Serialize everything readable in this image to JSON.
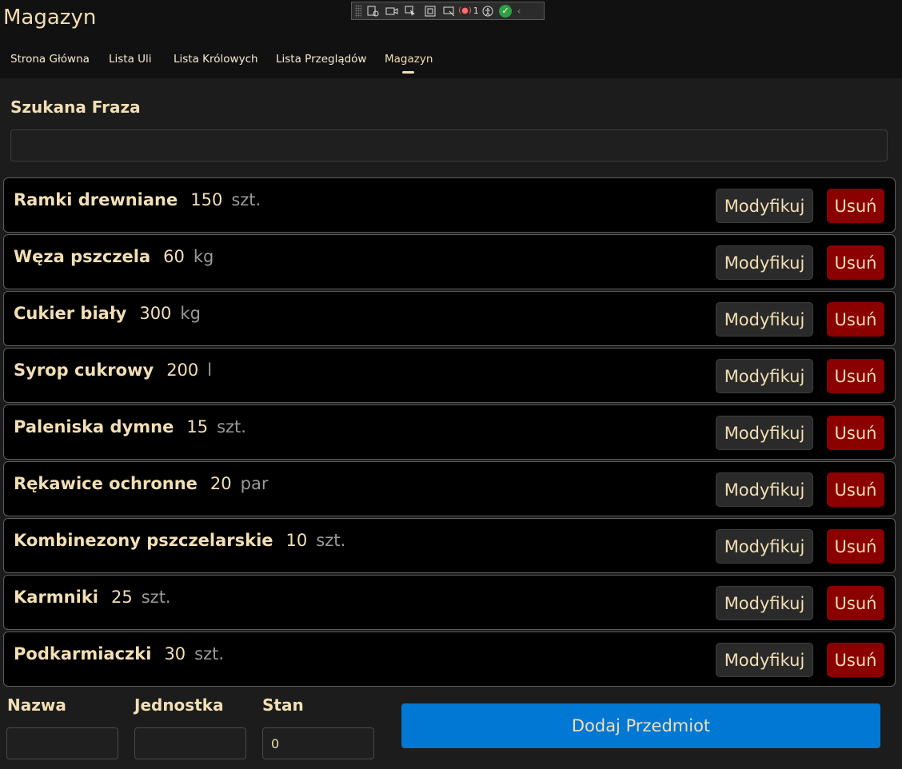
{
  "app": {
    "title": "Magazyn"
  },
  "devtools": {
    "error_count": "1",
    "icons": [
      "grid-icon",
      "video-icon",
      "select-icon",
      "frame-icon",
      "element-icon",
      "error-icon",
      "accessibility-icon",
      "check-icon",
      "chevron-left-icon"
    ]
  },
  "nav": {
    "items": [
      {
        "label": "Strona Główna"
      },
      {
        "label": "Lista Uli"
      },
      {
        "label": "Lista Królowych"
      },
      {
        "label": "Lista Przeglądów"
      },
      {
        "label": "Magazyn",
        "active": true
      }
    ]
  },
  "search": {
    "label": "Szukana Fraza",
    "value": ""
  },
  "items": [
    {
      "name": "Ramki drewniane",
      "quantity": "150",
      "unit": "szt."
    },
    {
      "name": "Węza pszczela",
      "quantity": "60",
      "unit": "kg"
    },
    {
      "name": "Cukier biały",
      "quantity": "300",
      "unit": "kg"
    },
    {
      "name": "Syrop cukrowy",
      "quantity": "200",
      "unit": "l"
    },
    {
      "name": "Paleniska dymne",
      "quantity": "15",
      "unit": "szt."
    },
    {
      "name": "Rękawice ochronne",
      "quantity": "20",
      "unit": "par"
    },
    {
      "name": "Kombinezony pszczelarskie",
      "quantity": "10",
      "unit": "szt."
    },
    {
      "name": "Karmniki",
      "quantity": "25",
      "unit": "szt."
    },
    {
      "name": "Podkarmiaczki",
      "quantity": "30",
      "unit": "szt."
    }
  ],
  "actions": {
    "modify_label": "Modyfikuj",
    "delete_label": "Usuń"
  },
  "form": {
    "name_label": "Nazwa",
    "name_value": "",
    "unit_label": "Jednostka",
    "unit_value": "",
    "stock_label": "Stan",
    "stock_value": "0",
    "add_label": "Dodaj Przedmiot"
  },
  "colors": {
    "background": "#1c1c1c",
    "text": "#f2dfb4",
    "delete": "#8b0000",
    "primary": "#0078d4",
    "row": "#000000"
  }
}
